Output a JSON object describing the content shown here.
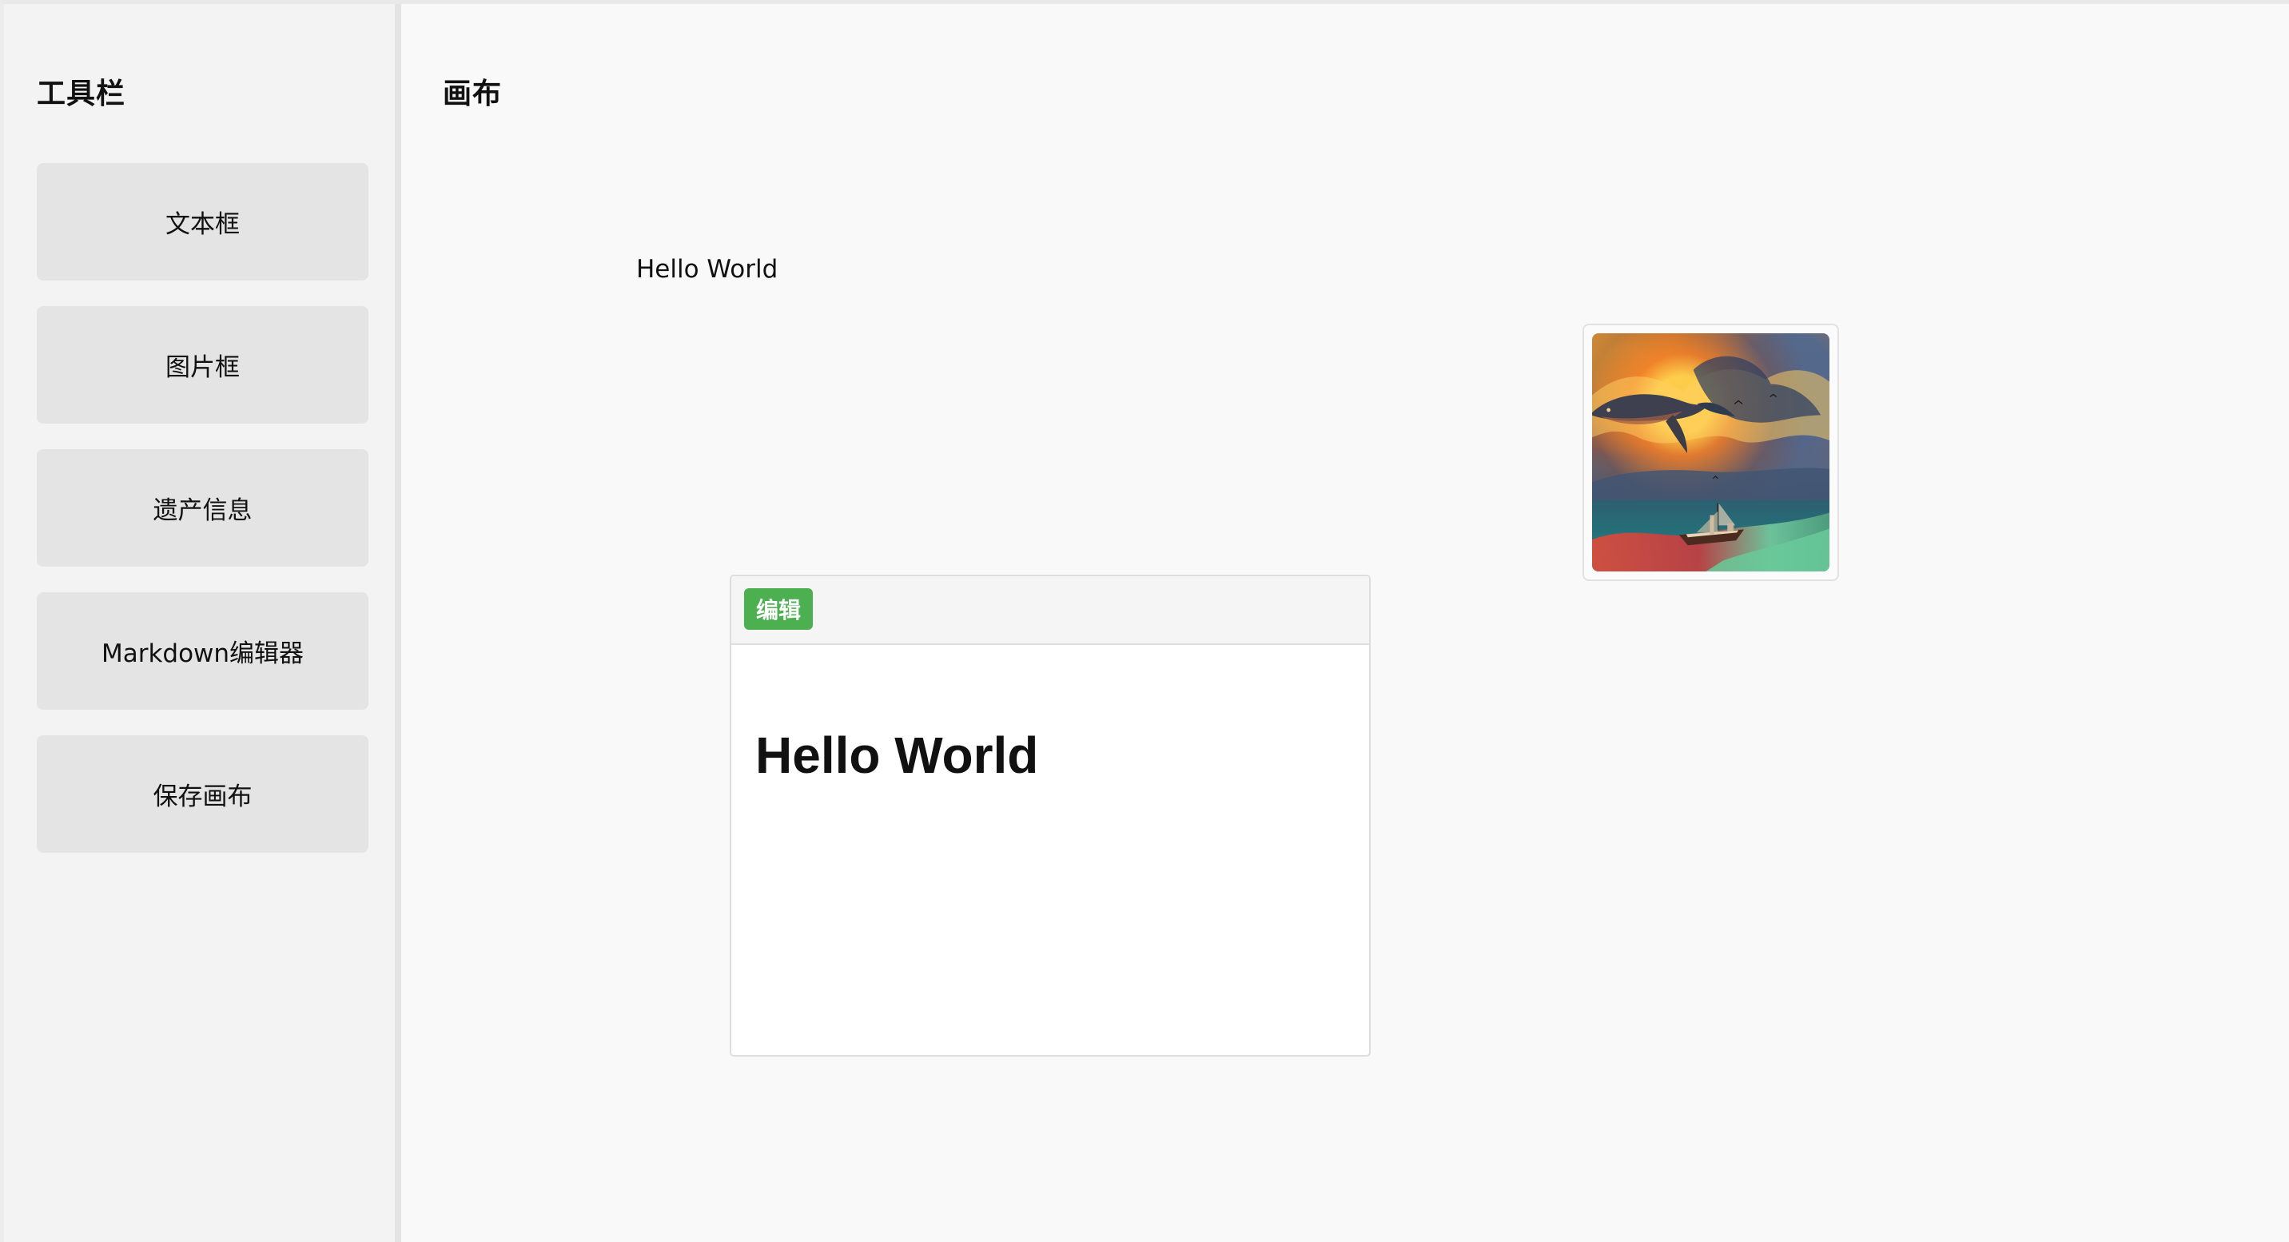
{
  "sidebar": {
    "title": "工具栏",
    "buttons": [
      {
        "label": "文本框"
      },
      {
        "label": "图片框"
      },
      {
        "label": "遗产信息"
      },
      {
        "label": "Markdown编辑器"
      },
      {
        "label": "保存画布"
      }
    ]
  },
  "canvas": {
    "title": "画布",
    "text_box": {
      "text": "Hello World"
    },
    "image_box": {
      "icon": "artwork-image"
    },
    "markdown_editor": {
      "edit_label": "编辑",
      "content": "Hello World"
    }
  },
  "colors": {
    "edit_button": "#4caf50",
    "sidebar_background": "#f3f3f3",
    "canvas_background": "#f9f9f9",
    "button_background": "#e4e4e4"
  }
}
